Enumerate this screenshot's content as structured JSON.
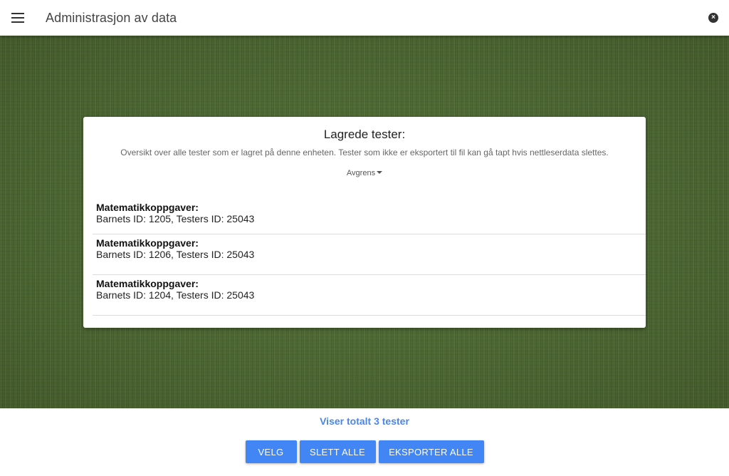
{
  "header": {
    "title": "Administrasjon av data",
    "menu_icon": "menu-icon",
    "close_icon": "close-icon",
    "close_glyph": "×"
  },
  "card": {
    "title": "Lagrede tester:",
    "subtitle": "Oversikt over alle tester som er lagret på denne enheten. Tester som ikke er eksportert til fil kan gå tapt hvis nettleserdata slettes.",
    "filter_label": "Avgrens"
  },
  "tests": [
    {
      "name": "Matematikkoppgaver:",
      "meta": "Barnets ID: 1205, Testers ID: 25043"
    },
    {
      "name": "Matematikkoppgaver:",
      "meta": "Barnets ID: 1206, Testers ID: 25043"
    },
    {
      "name": "Matematikkoppgaver:",
      "meta": "Barnets ID: 1204, Testers ID: 25043"
    }
  ],
  "footer": {
    "total_text": "Viser totalt 3 tester",
    "buttons": {
      "select": "VELG",
      "delete_all": "SLETT ALLE",
      "export_all": "EKSPORTER ALLE"
    }
  },
  "colors": {
    "accent": "#4285f4",
    "total_text": "#4a86e8",
    "background_green": "#4f6a30"
  }
}
